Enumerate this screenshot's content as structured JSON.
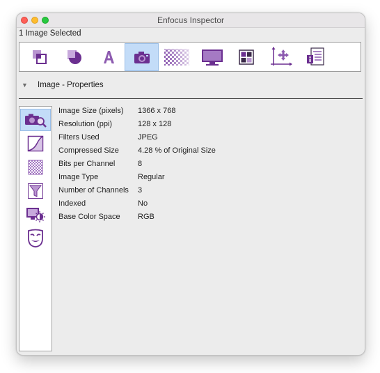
{
  "window": {
    "title": "Enfocus Inspector"
  },
  "selection_info": "1 Image Selected",
  "toolbar": {
    "tools": [
      {
        "name": "object-tool",
        "icon": "object-stack-icon",
        "active": false
      },
      {
        "name": "fill-stroke-tool",
        "icon": "fill-stroke-icon",
        "active": false
      },
      {
        "name": "text-tool",
        "icon": "text-a-icon",
        "active": false
      },
      {
        "name": "image-tool",
        "icon": "camera-icon",
        "active": true
      },
      {
        "name": "transparency-tool",
        "icon": "checkerboard-icon",
        "active": false
      },
      {
        "name": "display-tool",
        "icon": "monitor-icon",
        "active": false
      },
      {
        "name": "layout-tool",
        "icon": "grid-squares-icon",
        "active": false
      },
      {
        "name": "position-tool",
        "icon": "axes-move-icon",
        "active": false
      },
      {
        "name": "info-tool",
        "icon": "document-info-icon",
        "active": false
      }
    ]
  },
  "section": {
    "title": "Image - Properties",
    "expanded": true
  },
  "subtabs": [
    {
      "name": "properties",
      "icon": "camera-magnify-icon",
      "active": true
    },
    {
      "name": "curves",
      "icon": "curve-graph-icon",
      "active": false
    },
    {
      "name": "resample",
      "icon": "checker-resample-icon",
      "active": false
    },
    {
      "name": "filters",
      "icon": "funnel-icon",
      "active": false
    },
    {
      "name": "brightness",
      "icon": "monitor-sun-icon",
      "active": false
    },
    {
      "name": "mask",
      "icon": "theater-mask-icon",
      "active": false
    }
  ],
  "properties": [
    {
      "label": "Image Size (pixels)",
      "value": "1366 x 768"
    },
    {
      "label": "Resolution (ppi)",
      "value": "128 x 128"
    },
    {
      "label": "Filters Used",
      "value": "JPEG"
    },
    {
      "label": "Compressed Size",
      "value": "4.28 % of Original Size"
    },
    {
      "label": "Bits per Channel",
      "value": "8"
    },
    {
      "label": "Image Type",
      "value": "Regular"
    },
    {
      "label": "Number of Channels",
      "value": "3"
    },
    {
      "label": "Indexed",
      "value": "No"
    },
    {
      "label": "Base Color Space",
      "value": "RGB"
    }
  ],
  "colors": {
    "accent_purple": "#7a3f99",
    "selection_blue": "#c3dcf8"
  }
}
